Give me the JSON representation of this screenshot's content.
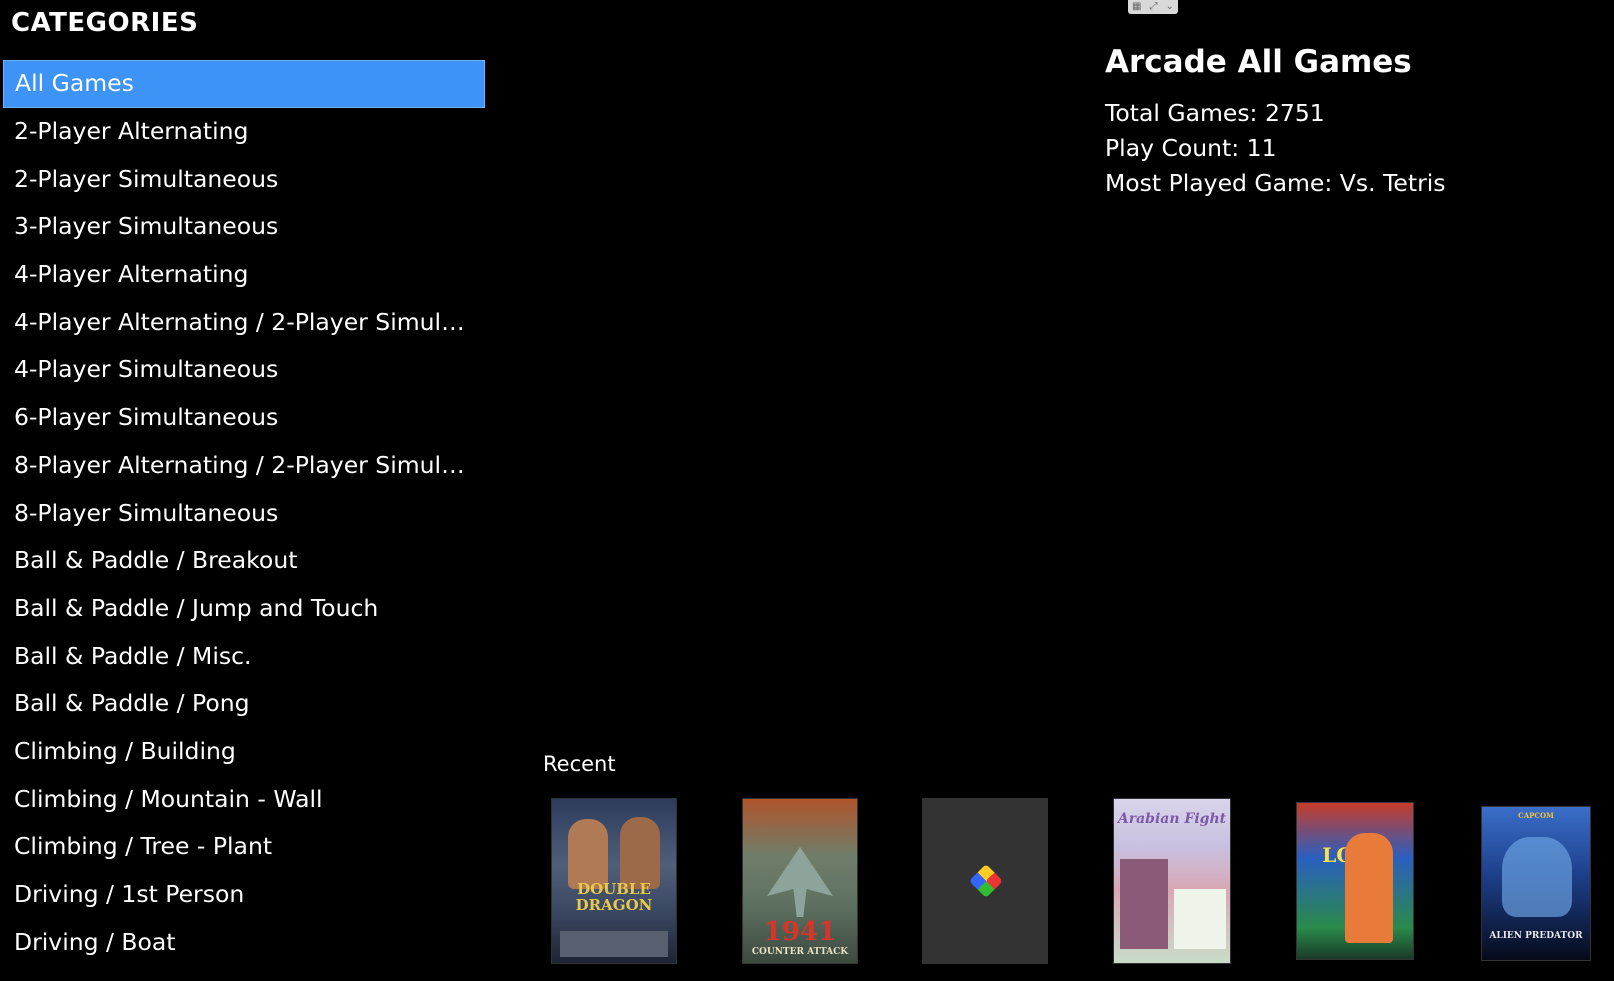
{
  "categories": {
    "title": "CATEGORIES",
    "items": [
      {
        "label": "All Games",
        "selected": true
      },
      {
        "label": "2-Player Alternating"
      },
      {
        "label": "2-Player Simultaneous"
      },
      {
        "label": "3-Player Simultaneous"
      },
      {
        "label": "4-Player Alternating"
      },
      {
        "label": "4-Player Alternating / 2-Player Simult..."
      },
      {
        "label": "4-Player Simultaneous"
      },
      {
        "label": "6-Player Simultaneous"
      },
      {
        "label": "8-Player Alternating / 2-Player Simult..."
      },
      {
        "label": "8-Player Simultaneous"
      },
      {
        "label": "Ball & Paddle / Breakout"
      },
      {
        "label": "Ball & Paddle / Jump and Touch"
      },
      {
        "label": "Ball & Paddle / Misc."
      },
      {
        "label": "Ball & Paddle / Pong"
      },
      {
        "label": "Climbing / Building"
      },
      {
        "label": "Climbing / Mountain - Wall"
      },
      {
        "label": "Climbing / Tree - Plant"
      },
      {
        "label": "Driving / 1st Person"
      },
      {
        "label": "Driving / Boat"
      }
    ]
  },
  "details": {
    "title": "Arcade All Games",
    "total_games": "Total Games: 2751",
    "play_count": "Play Count: 11",
    "most_played": "Most Played Game: Vs. Tetris"
  },
  "recent": {
    "label": "Recent",
    "items": [
      {
        "name": "double-dragon",
        "art_text": "DOUBLE DRAGON"
      },
      {
        "name": "1941-counter-attack",
        "art_text": "1941",
        "art_sub": "COUNTER ATTACK"
      },
      {
        "name": "placeholder-cube",
        "art_text": ""
      },
      {
        "name": "arabian-fight",
        "art_text": "Arabian Fight"
      },
      {
        "name": "lord-of-gun",
        "art_text": "LORD"
      },
      {
        "name": "alien-vs-predator",
        "art_text": "ALIEN PREDATOR",
        "art_sub": "CAPCOM"
      }
    ]
  },
  "colors": {
    "selection": "#3d94f6",
    "background": "#000000"
  }
}
